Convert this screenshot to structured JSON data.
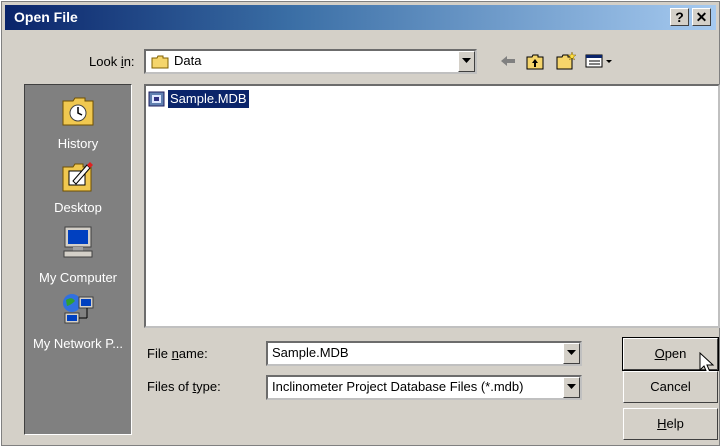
{
  "window": {
    "title": "Open File",
    "help_label": "?",
    "close_label": "✕"
  },
  "lookin": {
    "label_pre": "Look ",
    "label_u": "i",
    "label_post": "n:",
    "value": "Data"
  },
  "places": [
    {
      "label": "History",
      "icon": "history-icon"
    },
    {
      "label": "Desktop",
      "icon": "desktop-icon"
    },
    {
      "label": "My Computer",
      "icon": "my-computer-icon"
    },
    {
      "label": "My Network P...",
      "icon": "network-places-icon"
    }
  ],
  "files": [
    {
      "name": "Sample.MDB"
    }
  ],
  "filename": {
    "label_pre": "File ",
    "label_u": "n",
    "label_post": "ame:",
    "value": "Sample.MDB"
  },
  "filetype": {
    "label_pre": "Files of ",
    "label_u": "t",
    "label_post": "ype:",
    "value": "Inclinometer Project Database Files (*.mdb)"
  },
  "buttons": {
    "open": {
      "u": "O",
      "rest": "pen"
    },
    "cancel": {
      "label": "Cancel"
    },
    "help": {
      "u": "H",
      "rest": "elp"
    }
  }
}
